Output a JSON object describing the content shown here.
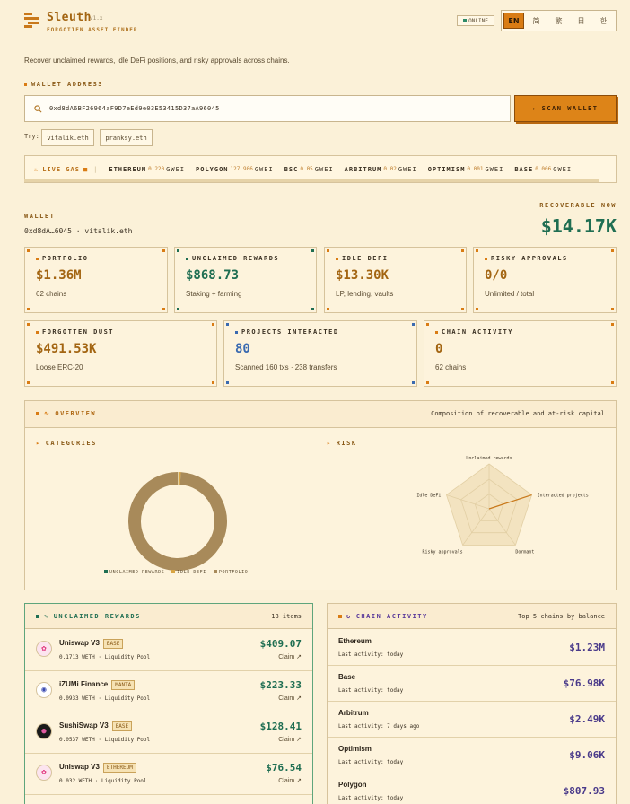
{
  "header": {
    "brand": "Sleuth",
    "version": "v1.x",
    "subtitle": "FORGOTTEN ASSET FINDER",
    "status": "ONLINE",
    "languages": [
      "EN",
      "简",
      "繁",
      "日",
      "한"
    ],
    "active_language": "EN"
  },
  "tagline": "Recover unclaimed rewards, idle DeFi positions, and risky approvals across chains.",
  "search": {
    "label": "WALLET ADDRESS",
    "value": "0xd8dA6BF26964aF9D7eEd9e03E53415D37aA96045",
    "scan_label": "SCAN WALLET",
    "try_label": "Try:",
    "suggestions": [
      "vitalik.eth",
      "pranksy.eth"
    ]
  },
  "gas": {
    "label": "LIVE GAS",
    "unit": "GWEI",
    "items": [
      {
        "chain": "ETHEREUM",
        "value": "0.220"
      },
      {
        "chain": "POLYGON",
        "value": "127.906"
      },
      {
        "chain": "BSC",
        "value": "0.05"
      },
      {
        "chain": "ARBITRUM",
        "value": "0.02"
      },
      {
        "chain": "OPTIMISM",
        "value": "0.001"
      },
      {
        "chain": "BASE",
        "value": "0.006"
      }
    ]
  },
  "wallet": {
    "label": "WALLET",
    "address": "0xd8dA…6045 · vitalik.eth",
    "recoverable_label": "RECOVERABLE NOW",
    "recoverable_value": "$14.17K"
  },
  "stats": [
    {
      "title": "PORTFOLIO",
      "value": "$1.36M",
      "sub": "62 chains",
      "color": "#a36512"
    },
    {
      "title": "UNCLAIMED REWARDS",
      "value": "$868.73",
      "sub": "Staking + farming",
      "color": "#1f6e52"
    },
    {
      "title": "IDLE DEFI",
      "value": "$13.30K",
      "sub": "LP, lending, vaults",
      "color": "#a36512"
    },
    {
      "title": "RISKY APPROVALS",
      "value": "0/0",
      "sub": "Unlimited / total",
      "color": "#a36512"
    },
    {
      "title": "FORGOTTEN DUST",
      "value": "$491.53K",
      "sub": "Loose ERC-20",
      "color": "#a36512"
    },
    {
      "title": "PROJECTS INTERACTED",
      "value": "80",
      "sub": "Scanned 160 txs · 238 transfers",
      "color": "#3a6ab0"
    },
    {
      "title": "CHAIN ACTIVITY",
      "value": "0",
      "sub": "62 chains",
      "color": "#a36512"
    }
  ],
  "overview": {
    "title": "OVERVIEW",
    "description": "Composition of recoverable and at-risk capital",
    "categories_label": "CATEGORIES",
    "risk_label": "RISK",
    "legend": [
      "UNCLAIMED REWARDS",
      "IDLE DEFI",
      "PORTFOLIO"
    ],
    "radar_axes": [
      "Unclaimed rewards",
      "Interacted projects",
      "Dormant",
      "Risky approvals",
      "Idle DeFi"
    ]
  },
  "chart_data": [
    {
      "type": "pie",
      "title": "CATEGORIES",
      "categories": [
        "UNCLAIMED REWARDS",
        "IDLE DEFI",
        "PORTFOLIO"
      ],
      "values": [
        868.73,
        13300,
        1360000
      ],
      "colors": [
        "#1f6e52",
        "#d9a441",
        "#a88a5a"
      ]
    },
    {
      "type": "radar",
      "title": "RISK",
      "categories": [
        "Unclaimed rewards",
        "Interacted projects",
        "Dormant",
        "Risky approvals",
        "Idle DeFi"
      ],
      "values": [
        0.0,
        1.0,
        0.0,
        0.0,
        0.0
      ]
    }
  ],
  "rewards": {
    "title": "UNCLAIMED REWARDS",
    "count": "18 items",
    "claim_label": "Claim",
    "items": [
      {
        "name": "Uniswap V3",
        "chain": "BASE",
        "detail": "0.1713 WETH · Liquidity Pool",
        "amount": "$409.07",
        "icon": "🦄"
      },
      {
        "name": "iZUMi Finance",
        "chain": "MANTA",
        "detail": "0.0933 WETH · Liquidity Pool",
        "amount": "$223.33",
        "icon": "◉"
      },
      {
        "name": "SushiSwap V3",
        "chain": "BASE",
        "detail": "0.0537 WETH · Liquidity Pool",
        "amount": "$128.41",
        "icon": "●"
      },
      {
        "name": "Uniswap V3",
        "chain": "ETHEREUM",
        "detail": "0.032 WETH · Liquidity Pool",
        "amount": "$76.54",
        "icon": "🦄"
      }
    ]
  },
  "chains": {
    "title": "CHAIN ACTIVITY",
    "description": "Top 5 chains by balance",
    "items": [
      {
        "name": "Ethereum",
        "activity": "Last activity: today",
        "amount": "$1.23M"
      },
      {
        "name": "Base",
        "activity": "Last activity: today",
        "amount": "$76.98K"
      },
      {
        "name": "Arbitrum",
        "activity": "Last activity: 7 days ago",
        "amount": "$2.49K"
      },
      {
        "name": "Optimism",
        "activity": "Last activity: today",
        "amount": "$9.06K"
      },
      {
        "name": "Polygon",
        "activity": "Last activity: today",
        "amount": "$807.93"
      }
    ]
  }
}
